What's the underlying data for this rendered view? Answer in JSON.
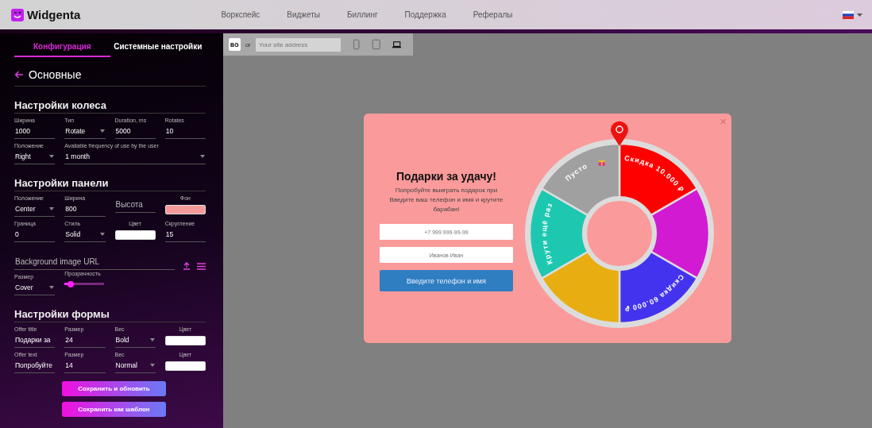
{
  "header": {
    "logo": "Widgenta",
    "nav": [
      "Воркспейс",
      "Виджеты",
      "Биллинг",
      "Поддержка",
      "Рефералы"
    ]
  },
  "sidebar": {
    "tabs": [
      {
        "label": "Конфигурация",
        "selected": true
      },
      {
        "label": "Системные настройки",
        "selected": false
      }
    ],
    "title": "Основные",
    "sections": [
      {
        "title": "Настройки колеса",
        "rows": [
          [
            {
              "kind": "input",
              "label": "Ширина",
              "value": "1000"
            },
            {
              "kind": "select",
              "label": "Тип",
              "value": "Rotate"
            },
            {
              "kind": "input",
              "label": "Duration, ms",
              "value": "5000"
            },
            {
              "kind": "input",
              "label": "Rotates",
              "value": "10"
            }
          ],
          [
            {
              "kind": "select",
              "label": "Положение",
              "value": "Right"
            },
            {
              "kind": "select",
              "label": "Available frequency of use by the user",
              "value": "1 month"
            }
          ]
        ]
      },
      {
        "title": "Настройки панели",
        "rows": [
          [
            {
              "kind": "select",
              "label": "Положение",
              "value": "Center"
            },
            {
              "kind": "input",
              "label": "Ширина",
              "value": "800"
            },
            {
              "kind": "input",
              "placeholder": "Высота"
            },
            {
              "kind": "color",
              "label": "Фон",
              "color": "#f59a9a"
            }
          ],
          [
            {
              "kind": "input",
              "label": "Граница",
              "value": "0"
            },
            {
              "kind": "select",
              "label": "Стиль",
              "value": "Solid"
            },
            {
              "kind": "color",
              "label": "Цвет",
              "color": "#ffffff"
            },
            {
              "kind": "input",
              "label": "Скругление",
              "value": "15"
            }
          ],
          [
            {
              "kind": "url",
              "placeholder": "Background image URL"
            }
          ],
          [
            {
              "kind": "select",
              "label": "Размер",
              "value": "Cover"
            },
            {
              "kind": "slider",
              "label": "Прозрачность",
              "level": 0.15
            }
          ]
        ]
      },
      {
        "title": "Настройки формы",
        "rows": [
          [
            {
              "kind": "input",
              "label": "Offer title",
              "value": "Подарки за"
            },
            {
              "kind": "input",
              "label": "Размер",
              "value": "24"
            },
            {
              "kind": "select",
              "label": "Вес",
              "value": "Bold"
            },
            {
              "kind": "color",
              "label": "Цвет",
              "color": "#ffffff"
            }
          ],
          [
            {
              "kind": "input",
              "label": "Offer text",
              "value": "Попробуйте"
            },
            {
              "kind": "input",
              "label": "Размер",
              "value": "14"
            },
            {
              "kind": "select",
              "label": "Вес",
              "value": "Normal"
            },
            {
              "kind": "color",
              "label": "Цвет",
              "color": "#ffffff"
            }
          ]
        ]
      }
    ],
    "buttons": [
      "Сохранить и обновить",
      "Сохранить как шаблон"
    ]
  },
  "preview": {
    "bg_button": "BG",
    "or": "or",
    "address": {
      "placeholder": "Your site address"
    },
    "devices": [
      {
        "kind": "phone",
        "selected": false
      },
      {
        "kind": "tablet",
        "selected": false
      },
      {
        "kind": "laptop",
        "selected": true
      }
    ],
    "popup": {
      "title": "Подарки за удачу!",
      "text": "Попробуйте выиграть подарок при Введите ваш телефон и имя и крутите барабан!",
      "phone": {
        "placeholder": "+7 999 999-99-99"
      },
      "name": {
        "placeholder": "Иванов Иван"
      },
      "button": "Введите телефон и имя",
      "close": "×",
      "wheel": [
        {
          "label": "Скидка 10.000 ₽",
          "color": "#ff0000"
        },
        {
          "color": "#d21ad2"
        },
        {
          "label": "Скидка 60.000 ₽",
          "color": "#4433ee"
        },
        {
          "color": "#e8ad10"
        },
        {
          "label": "Крути ещё раз",
          "color": "#1ec8b0"
        },
        {
          "label": "Пусто",
          "color": "#a0a0a0",
          "icon": true
        }
      ]
    }
  }
}
